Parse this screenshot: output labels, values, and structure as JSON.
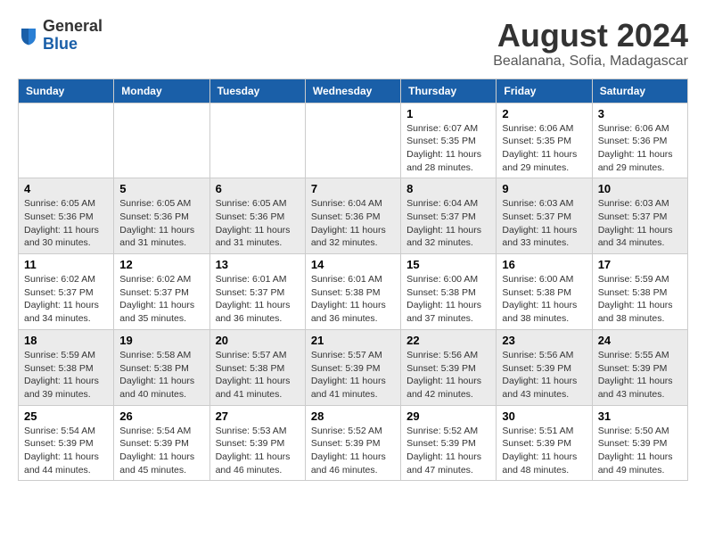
{
  "header": {
    "logo_general": "General",
    "logo_blue": "Blue",
    "month_year": "August 2024",
    "location": "Bealanana, Sofia, Madagascar"
  },
  "days_of_week": [
    "Sunday",
    "Monday",
    "Tuesday",
    "Wednesday",
    "Thursday",
    "Friday",
    "Saturday"
  ],
  "weeks": [
    [
      {
        "day": "",
        "info": ""
      },
      {
        "day": "",
        "info": ""
      },
      {
        "day": "",
        "info": ""
      },
      {
        "day": "",
        "info": ""
      },
      {
        "day": "1",
        "info": "Sunrise: 6:07 AM\nSunset: 5:35 PM\nDaylight: 11 hours and 28 minutes."
      },
      {
        "day": "2",
        "info": "Sunrise: 6:06 AM\nSunset: 5:35 PM\nDaylight: 11 hours and 29 minutes."
      },
      {
        "day": "3",
        "info": "Sunrise: 6:06 AM\nSunset: 5:36 PM\nDaylight: 11 hours and 29 minutes."
      }
    ],
    [
      {
        "day": "4",
        "info": "Sunrise: 6:05 AM\nSunset: 5:36 PM\nDaylight: 11 hours and 30 minutes."
      },
      {
        "day": "5",
        "info": "Sunrise: 6:05 AM\nSunset: 5:36 PM\nDaylight: 11 hours and 31 minutes."
      },
      {
        "day": "6",
        "info": "Sunrise: 6:05 AM\nSunset: 5:36 PM\nDaylight: 11 hours and 31 minutes."
      },
      {
        "day": "7",
        "info": "Sunrise: 6:04 AM\nSunset: 5:36 PM\nDaylight: 11 hours and 32 minutes."
      },
      {
        "day": "8",
        "info": "Sunrise: 6:04 AM\nSunset: 5:37 PM\nDaylight: 11 hours and 32 minutes."
      },
      {
        "day": "9",
        "info": "Sunrise: 6:03 AM\nSunset: 5:37 PM\nDaylight: 11 hours and 33 minutes."
      },
      {
        "day": "10",
        "info": "Sunrise: 6:03 AM\nSunset: 5:37 PM\nDaylight: 11 hours and 34 minutes."
      }
    ],
    [
      {
        "day": "11",
        "info": "Sunrise: 6:02 AM\nSunset: 5:37 PM\nDaylight: 11 hours and 34 minutes."
      },
      {
        "day": "12",
        "info": "Sunrise: 6:02 AM\nSunset: 5:37 PM\nDaylight: 11 hours and 35 minutes."
      },
      {
        "day": "13",
        "info": "Sunrise: 6:01 AM\nSunset: 5:37 PM\nDaylight: 11 hours and 36 minutes."
      },
      {
        "day": "14",
        "info": "Sunrise: 6:01 AM\nSunset: 5:38 PM\nDaylight: 11 hours and 36 minutes."
      },
      {
        "day": "15",
        "info": "Sunrise: 6:00 AM\nSunset: 5:38 PM\nDaylight: 11 hours and 37 minutes."
      },
      {
        "day": "16",
        "info": "Sunrise: 6:00 AM\nSunset: 5:38 PM\nDaylight: 11 hours and 38 minutes."
      },
      {
        "day": "17",
        "info": "Sunrise: 5:59 AM\nSunset: 5:38 PM\nDaylight: 11 hours and 38 minutes."
      }
    ],
    [
      {
        "day": "18",
        "info": "Sunrise: 5:59 AM\nSunset: 5:38 PM\nDaylight: 11 hours and 39 minutes."
      },
      {
        "day": "19",
        "info": "Sunrise: 5:58 AM\nSunset: 5:38 PM\nDaylight: 11 hours and 40 minutes."
      },
      {
        "day": "20",
        "info": "Sunrise: 5:57 AM\nSunset: 5:38 PM\nDaylight: 11 hours and 41 minutes."
      },
      {
        "day": "21",
        "info": "Sunrise: 5:57 AM\nSunset: 5:39 PM\nDaylight: 11 hours and 41 minutes."
      },
      {
        "day": "22",
        "info": "Sunrise: 5:56 AM\nSunset: 5:39 PM\nDaylight: 11 hours and 42 minutes."
      },
      {
        "day": "23",
        "info": "Sunrise: 5:56 AM\nSunset: 5:39 PM\nDaylight: 11 hours and 43 minutes."
      },
      {
        "day": "24",
        "info": "Sunrise: 5:55 AM\nSunset: 5:39 PM\nDaylight: 11 hours and 43 minutes."
      }
    ],
    [
      {
        "day": "25",
        "info": "Sunrise: 5:54 AM\nSunset: 5:39 PM\nDaylight: 11 hours and 44 minutes."
      },
      {
        "day": "26",
        "info": "Sunrise: 5:54 AM\nSunset: 5:39 PM\nDaylight: 11 hours and 45 minutes."
      },
      {
        "day": "27",
        "info": "Sunrise: 5:53 AM\nSunset: 5:39 PM\nDaylight: 11 hours and 46 minutes."
      },
      {
        "day": "28",
        "info": "Sunrise: 5:52 AM\nSunset: 5:39 PM\nDaylight: 11 hours and 46 minutes."
      },
      {
        "day": "29",
        "info": "Sunrise: 5:52 AM\nSunset: 5:39 PM\nDaylight: 11 hours and 47 minutes."
      },
      {
        "day": "30",
        "info": "Sunrise: 5:51 AM\nSunset: 5:39 PM\nDaylight: 11 hours and 48 minutes."
      },
      {
        "day": "31",
        "info": "Sunrise: 5:50 AM\nSunset: 5:39 PM\nDaylight: 11 hours and 49 minutes."
      }
    ]
  ]
}
